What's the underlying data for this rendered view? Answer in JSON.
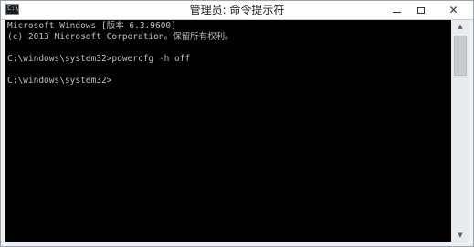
{
  "window": {
    "title": "管理员: 命令提示符",
    "icon": "cmd-icon",
    "icon_glyph": "C:\\"
  },
  "caption_buttons": {
    "minimize": "minimize-icon",
    "maximize": "maximize-icon",
    "close": "close-icon",
    "close_glyph": "✕"
  },
  "console": {
    "lines": [
      "Microsoft Windows [版本 6.3.9600]",
      "(c) 2013 Microsoft Corporation。保留所有权利。",
      "",
      "C:\\windows\\system32>powercfg -h off",
      "",
      "C:\\windows\\system32>"
    ]
  },
  "scrollbar": {
    "up_glyph": "▲",
    "down_glyph": "▼"
  },
  "colors": {
    "console_bg": "#000000",
    "console_text": "#c0c0c0",
    "titlebar_bg": "#ffffff"
  }
}
